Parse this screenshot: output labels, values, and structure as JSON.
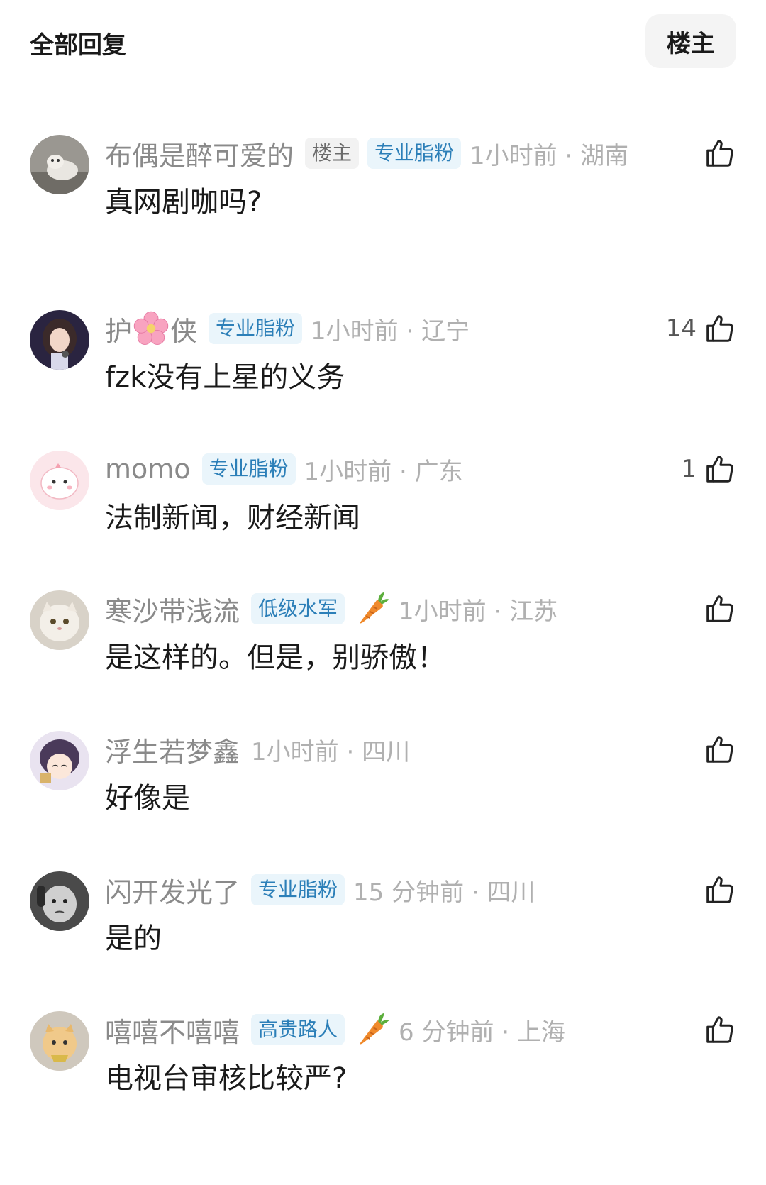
{
  "header": {
    "title": "全部回复",
    "op_filter_label": "楼主"
  },
  "comments": [
    {
      "username": "布偶是醉可爱的",
      "badges": [
        "楼主",
        "专业脂粉"
      ],
      "time_location": "1小时前 · 湖南",
      "content": "真网剧咖吗?",
      "likes": ""
    },
    {
      "username_part1": "护",
      "username_part2": "侠",
      "badges": [
        "专业脂粉"
      ],
      "time_location": "1小时前 · 辽宁",
      "content": "fzk没有上星的义务",
      "likes": "14"
    },
    {
      "username": "momo",
      "badges": [
        "专业脂粉"
      ],
      "time_location": "1小时前 · 广东",
      "content": "法制新闻，财经新闻",
      "likes": "1"
    },
    {
      "username": "寒沙带浅流",
      "badges": [
        "低级水军"
      ],
      "time_location": "1小时前 · 江苏",
      "content": "是这样的。但是，别骄傲！",
      "likes": ""
    },
    {
      "username": "浮生若梦鑫",
      "badges": [],
      "time_location": "1小时前 · 四川",
      "content": "好像是",
      "likes": ""
    },
    {
      "username": "闪开发光了",
      "badges": [
        "专业脂粉"
      ],
      "time_location": "15 分钟前 · 四川",
      "content": "是的",
      "likes": ""
    },
    {
      "username": "嘻嘻不嘻嘻",
      "badges": [
        "高贵路人"
      ],
      "time_location": "6 分钟前 · 上海",
      "content": "电视台审核比较严?",
      "likes": ""
    }
  ],
  "icons": {
    "like": "thumbs-up-icon",
    "carrot": "carrot-icon",
    "flower": "cherry-blossom-icon"
  },
  "colors": {
    "badge_fan_bg": "#eaf5fb",
    "badge_fan_text": "#2c7fb8",
    "meta_text": "#b0b0b0"
  }
}
